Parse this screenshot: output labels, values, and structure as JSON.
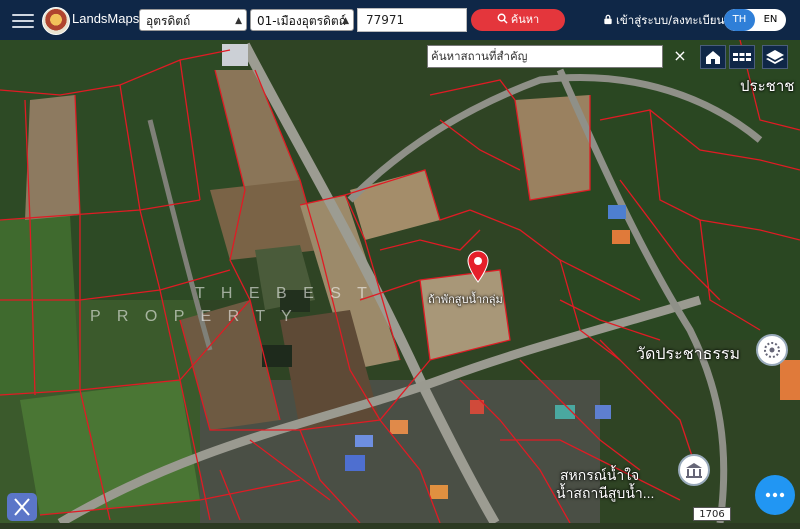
{
  "header": {
    "brand": "LandsMaps",
    "province": "อุตรดิตถ์",
    "district": "01-เมืองอุตรดิตถ์",
    "parcel_number": "77971",
    "search_label": "ค้นหา",
    "login_label": "เข้าสู่ระบบ/ลงทะเบียน",
    "lang_th": "TH",
    "lang_en": "EN"
  },
  "map": {
    "place_search_placeholder": "ค้นหาสถานที่สำคัญ",
    "close_glyph": "×",
    "labels": {
      "top_right": "ประชาช",
      "temple": "วัดประชาธรรม",
      "coop_line1": "สหกรณ์น้ำใจ",
      "coop_line2": "น้ำสถานีสูบน้ำ...",
      "marker_caption": "ถ้าพักสูบน้ำกลุ่ม",
      "road_badge": "1706"
    },
    "watermark_row1": "T H E   B E S T",
    "watermark_row2": "P R O P E R T Y"
  }
}
